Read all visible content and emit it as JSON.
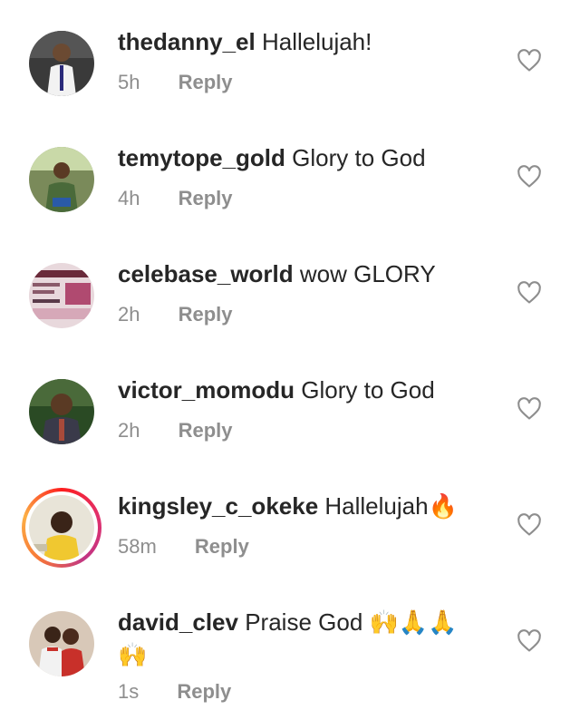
{
  "comments": [
    {
      "username": "thedanny_el",
      "text": "Hallelujah!",
      "time": "5h",
      "reply": "Reply",
      "avatar": "person-icon"
    },
    {
      "username": "temytope_gold",
      "text": "Glory to God",
      "time": "4h",
      "reply": "Reply",
      "avatar": "person-icon"
    },
    {
      "username": "celebase_world",
      "text": "wow GLORY",
      "time": "2h",
      "reply": "Reply",
      "avatar": "flyer-icon"
    },
    {
      "username": "victor_momodu",
      "text": "Glory to God",
      "time": "2h",
      "reply": "Reply",
      "avatar": "person-icon"
    },
    {
      "username": "kingsley_c_okeke",
      "text": "Hallelujah",
      "emoji": "🔥",
      "time": "58m",
      "reply": "Reply",
      "avatar": "person-icon",
      "has_story_ring": true
    },
    {
      "username": "david_clev",
      "text": "Praise God",
      "emoji": "🙌🙏🙏",
      "emoji_line2": "🙌",
      "time": "1s",
      "reply": "Reply",
      "avatar": "couple-icon"
    }
  ],
  "colors": {
    "text": "#262626",
    "muted": "#8e8e8e",
    "heart_outline": "#8e8e8e"
  }
}
